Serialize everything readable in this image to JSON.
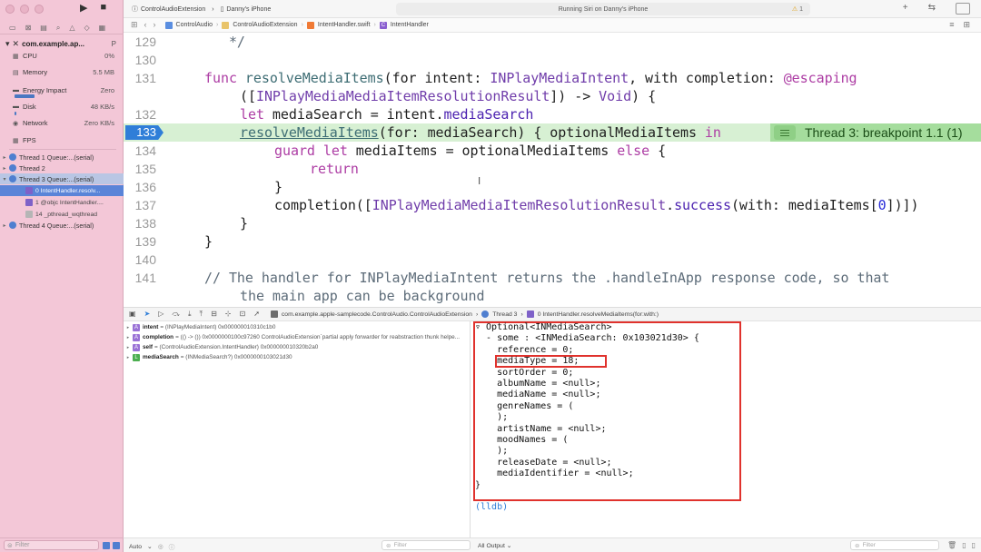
{
  "toolbar": {
    "scheme_target": "ControlAudioExtension",
    "scheme_device": "Danny's iPhone",
    "status_text": "Running Siri on Danny's iPhone",
    "warning_count": "1"
  },
  "jumpbar": {
    "crumbs": [
      "ControlAudio",
      "ControlAudioExtension",
      "IntentHandler.swift",
      "IntentHandler"
    ]
  },
  "sidebar": {
    "process_name": "com.example.ap...",
    "process_meta": "P",
    "gauges": [
      {
        "label": "CPU",
        "value": "0%",
        "icon": "cpu-icon"
      },
      {
        "label": "Memory",
        "value": "5.5 MB",
        "icon": "memory-icon"
      },
      {
        "label": "Energy Impact",
        "value": "Zero",
        "icon": "energy-icon"
      },
      {
        "label": "Disk",
        "value": "48 KB/s",
        "icon": "disk-icon"
      },
      {
        "label": "Network",
        "value": "Zero KB/s",
        "icon": "network-icon"
      },
      {
        "label": "FPS",
        "value": "",
        "icon": "fps-icon"
      }
    ],
    "threads": [
      "Thread 1 Queue:...(serial)",
      "Thread 2",
      "Thread 3 Queue:...(serial)",
      "0 IntentHandler.resolv...",
      "1 @objc IntentHandler....",
      "14 _pthread_wqthread",
      "Thread 4 Queue:...(serial)"
    ],
    "filter_placeholder": "Filter"
  },
  "editor": {
    "line_numbers": [
      "129",
      "130",
      "131",
      "",
      "132",
      "133",
      "134",
      "135",
      "136",
      "137",
      "138",
      "139",
      "140",
      "141",
      ""
    ],
    "breakpoint_label": "Thread 3: breakpoint 1.1 (1)"
  },
  "debugbar": {
    "crumbs": [
      "com.example.apple-samplecode.ControlAudio.ControlAudioExtension",
      "Thread 3",
      "0 IntentHandler.resolveMediaItems(for:with:)"
    ]
  },
  "variables": [
    {
      "kind": "A",
      "name": "intent",
      "value": "= (INPlayMediaIntent) 0x000000010310c1b0"
    },
    {
      "kind": "A",
      "name": "completion",
      "value": "= (() -> ()) 0x0000000100c97260 ControlAudioExtension`partial apply forwarder for reabstraction thunk helpe..."
    },
    {
      "kind": "A",
      "name": "self",
      "value": "= (ControlAudioExtension.IntentHandler) 0x000000010320b2a0"
    },
    {
      "kind": "L",
      "name": "mediaSearch",
      "value": "= (INMediaSearch?) 0x0000000103021d30"
    }
  ],
  "console": {
    "lines": [
      "▿ Optional<INMediaSearch>",
      "  - some : <INMediaSearch: 0x103021d30> {",
      "    reference = 0;",
      "    mediaType = 18;",
      "    sortOrder = 0;",
      "    albumName = <null>;",
      "    mediaName = <null>;",
      "    genreNames = (",
      "    );",
      "    artistName = <null>;",
      "    moodNames = (",
      "    );",
      "    releaseDate = <null>;",
      "    mediaIdentifier = <null>;",
      "}"
    ],
    "prompt": "(lldb)"
  },
  "bottom": {
    "scope": "Auto",
    "filter_placeholder": "Filter",
    "output": "All Output"
  }
}
